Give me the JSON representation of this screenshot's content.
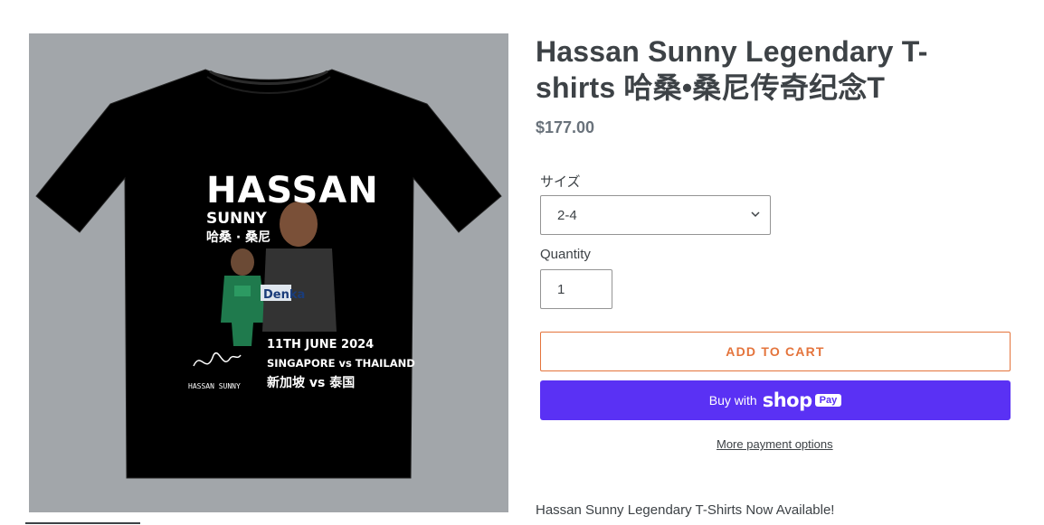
{
  "product": {
    "title": "Hassan Sunny Legendary T-shirts 哈桑•桑尼传奇纪念T",
    "price": "$177.00",
    "description_intro": "Hassan Sunny Legendary T-Shirts Now Available!"
  },
  "image": {
    "shirt_text": {
      "name_line1": "HASSAN",
      "name_line2": "SUNNY",
      "name_chinese": "哈桑 · 桑尼",
      "date": "11TH JUNE 2024",
      "match": "SINGAPORE vs THAILAND",
      "match_chinese": "新加坡 vs 泰国",
      "signature_caption": "HASSAN SUNNY",
      "sponsor": "Denka"
    }
  },
  "form": {
    "size_label": "サイズ",
    "size_value": "2-4",
    "quantity_label": "Quantity",
    "quantity_value": "1",
    "add_to_cart": "ADD TO CART",
    "buy_with": "Buy with",
    "shop_word": "shop",
    "pay_badge": "Pay",
    "more_payment": "More payment options"
  },
  "colors": {
    "accent": "#e4743c",
    "shop_pay": "#5a31f4",
    "image_background": "#a2a6aa"
  }
}
